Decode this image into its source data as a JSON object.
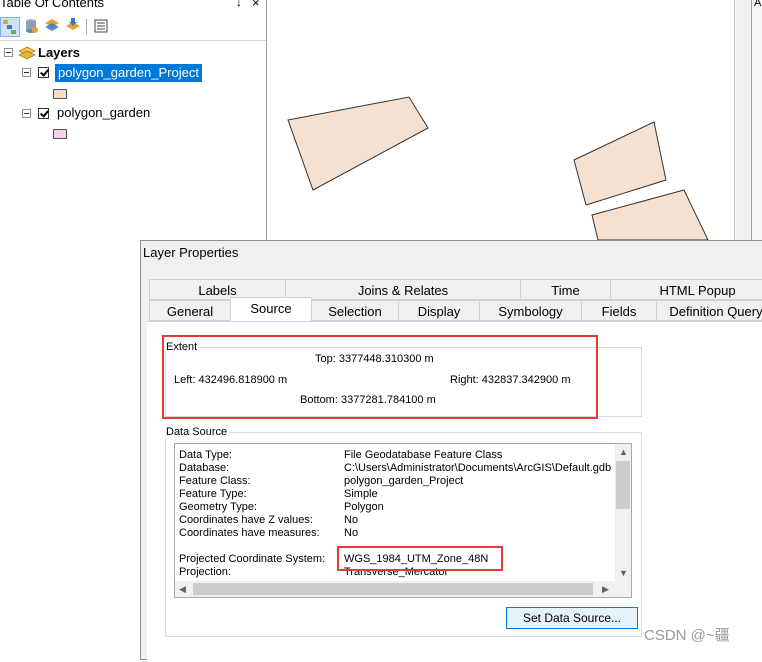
{
  "toc": {
    "title": "Table Of Contents",
    "pin": "↓",
    "close": "×",
    "root_label": "Layers",
    "layers": [
      {
        "name": "polygon_garden_Project",
        "swatch": "#f6dcc8",
        "selected": true
      },
      {
        "name": "polygon_garden",
        "swatch": "#f1d0f0",
        "selected": false
      }
    ]
  },
  "map": {
    "polygon_fill": "#f6e0d0",
    "polygon_stroke": "#333333",
    "side_letter": "A"
  },
  "dialog": {
    "title": "Layer Properties",
    "tabs_row1": [
      "Labels",
      "Joins & Relates",
      "Time",
      "HTML Popup"
    ],
    "tabs_row2": [
      "General",
      "Source",
      "Selection",
      "Display",
      "Symbology",
      "Fields",
      "Definition Query"
    ],
    "active_tab": "Source",
    "extent": {
      "label": "Extent",
      "top": "Top:  3377448.310300 m",
      "left": "Left: 432496.818900 m",
      "right": "Right:  432837.342900 m",
      "bottom": "Bottom:  3377281.784100 m"
    },
    "data_source": {
      "label": "Data Source",
      "rows": [
        {
          "key": "Data Type:",
          "value": "File Geodatabase Feature Class"
        },
        {
          "key": "Database:",
          "value": "C:\\Users\\Administrator\\Documents\\ArcGIS\\Default.gdb"
        },
        {
          "key": "Feature Class:",
          "value": "polygon_garden_Project"
        },
        {
          "key": "Feature Type:",
          "value": "Simple"
        },
        {
          "key": "Geometry Type:",
          "value": "Polygon"
        },
        {
          "key": "Coordinates have Z values:",
          "value": "No"
        },
        {
          "key": "Coordinates have measures:",
          "value": "No"
        },
        {
          "key": "",
          "value": ""
        },
        {
          "key": "Projected Coordinate System:",
          "value": "WGS_1984_UTM_Zone_48N"
        },
        {
          "key": "Projection:",
          "value": "Transverse_Mercator"
        }
      ],
      "button": "Set Data Source..."
    },
    "highlight_color": "#e43a3a"
  },
  "watermark": "CSDN @~疆"
}
